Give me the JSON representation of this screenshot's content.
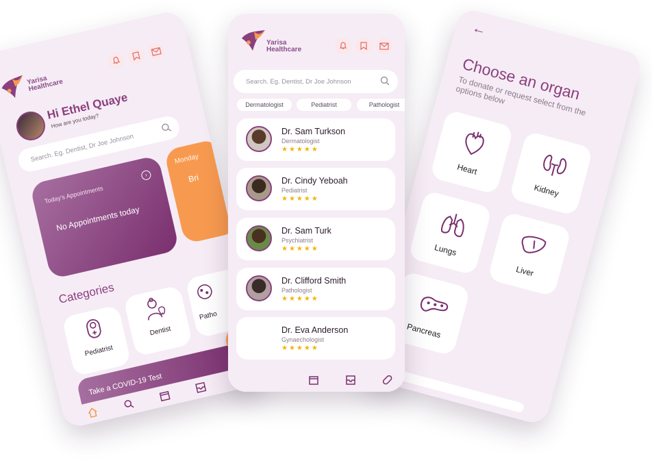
{
  "brand": {
    "line1": "Yarisa",
    "line2": "Healthcare"
  },
  "home": {
    "greeting": "Hi Ethel Quaye",
    "subgreeting": "How are you today?",
    "search_placeholder": "Search. Eg. Dentist, Dr Joe Johnson",
    "appointments_title": "Today's Appointments",
    "appointments_empty": "No Appointments today",
    "next_card_title": "Monday",
    "next_card_text": "Bri",
    "categories_title": "Categories",
    "categories": [
      "Pediatrist",
      "Dentist",
      "Patho"
    ],
    "covid_banner": "Take a COVID-19 Test"
  },
  "doctors_screen": {
    "search_placeholder": "Search. Eg. Dentist, Dr Joe Johnson",
    "filters": [
      "Dermatologist",
      "Pediatrist",
      "Pathologist"
    ],
    "doctors": [
      {
        "name": "Dr. Sam Turkson",
        "specialty": "Dermatologist",
        "stars": "★★★★★"
      },
      {
        "name": "Dr. Cindy Yeboah",
        "specialty": "Pediatrist",
        "stars": "★★★★★"
      },
      {
        "name": "Dr. Sam Turk",
        "specialty": "Psychiatrist",
        "stars": "★★★★★"
      },
      {
        "name": "Dr. Clifford Smith",
        "specialty": "Pathologist",
        "stars": "★★★★★"
      },
      {
        "name": "Dr. Eva Anderson",
        "specialty": "Gynaechologist",
        "stars": "★★★★★"
      }
    ]
  },
  "organ_screen": {
    "back": "←",
    "title": "Choose an organ",
    "subtitle": "To donate or request select from the options below",
    "organs": [
      "Heart",
      "Kidney",
      "Lungs",
      "Liver",
      "Pancreas"
    ]
  },
  "colors": {
    "accent": "#8a3f7e",
    "orange": "#f79a4f",
    "bg": "#f6ecf5"
  },
  "icons": [
    "bell-icon",
    "bookmark-icon",
    "mail-icon",
    "search-icon",
    "home-icon",
    "calendar-icon",
    "inbox-icon",
    "pill-icon",
    "chat-icon",
    "back-arrow-icon"
  ]
}
